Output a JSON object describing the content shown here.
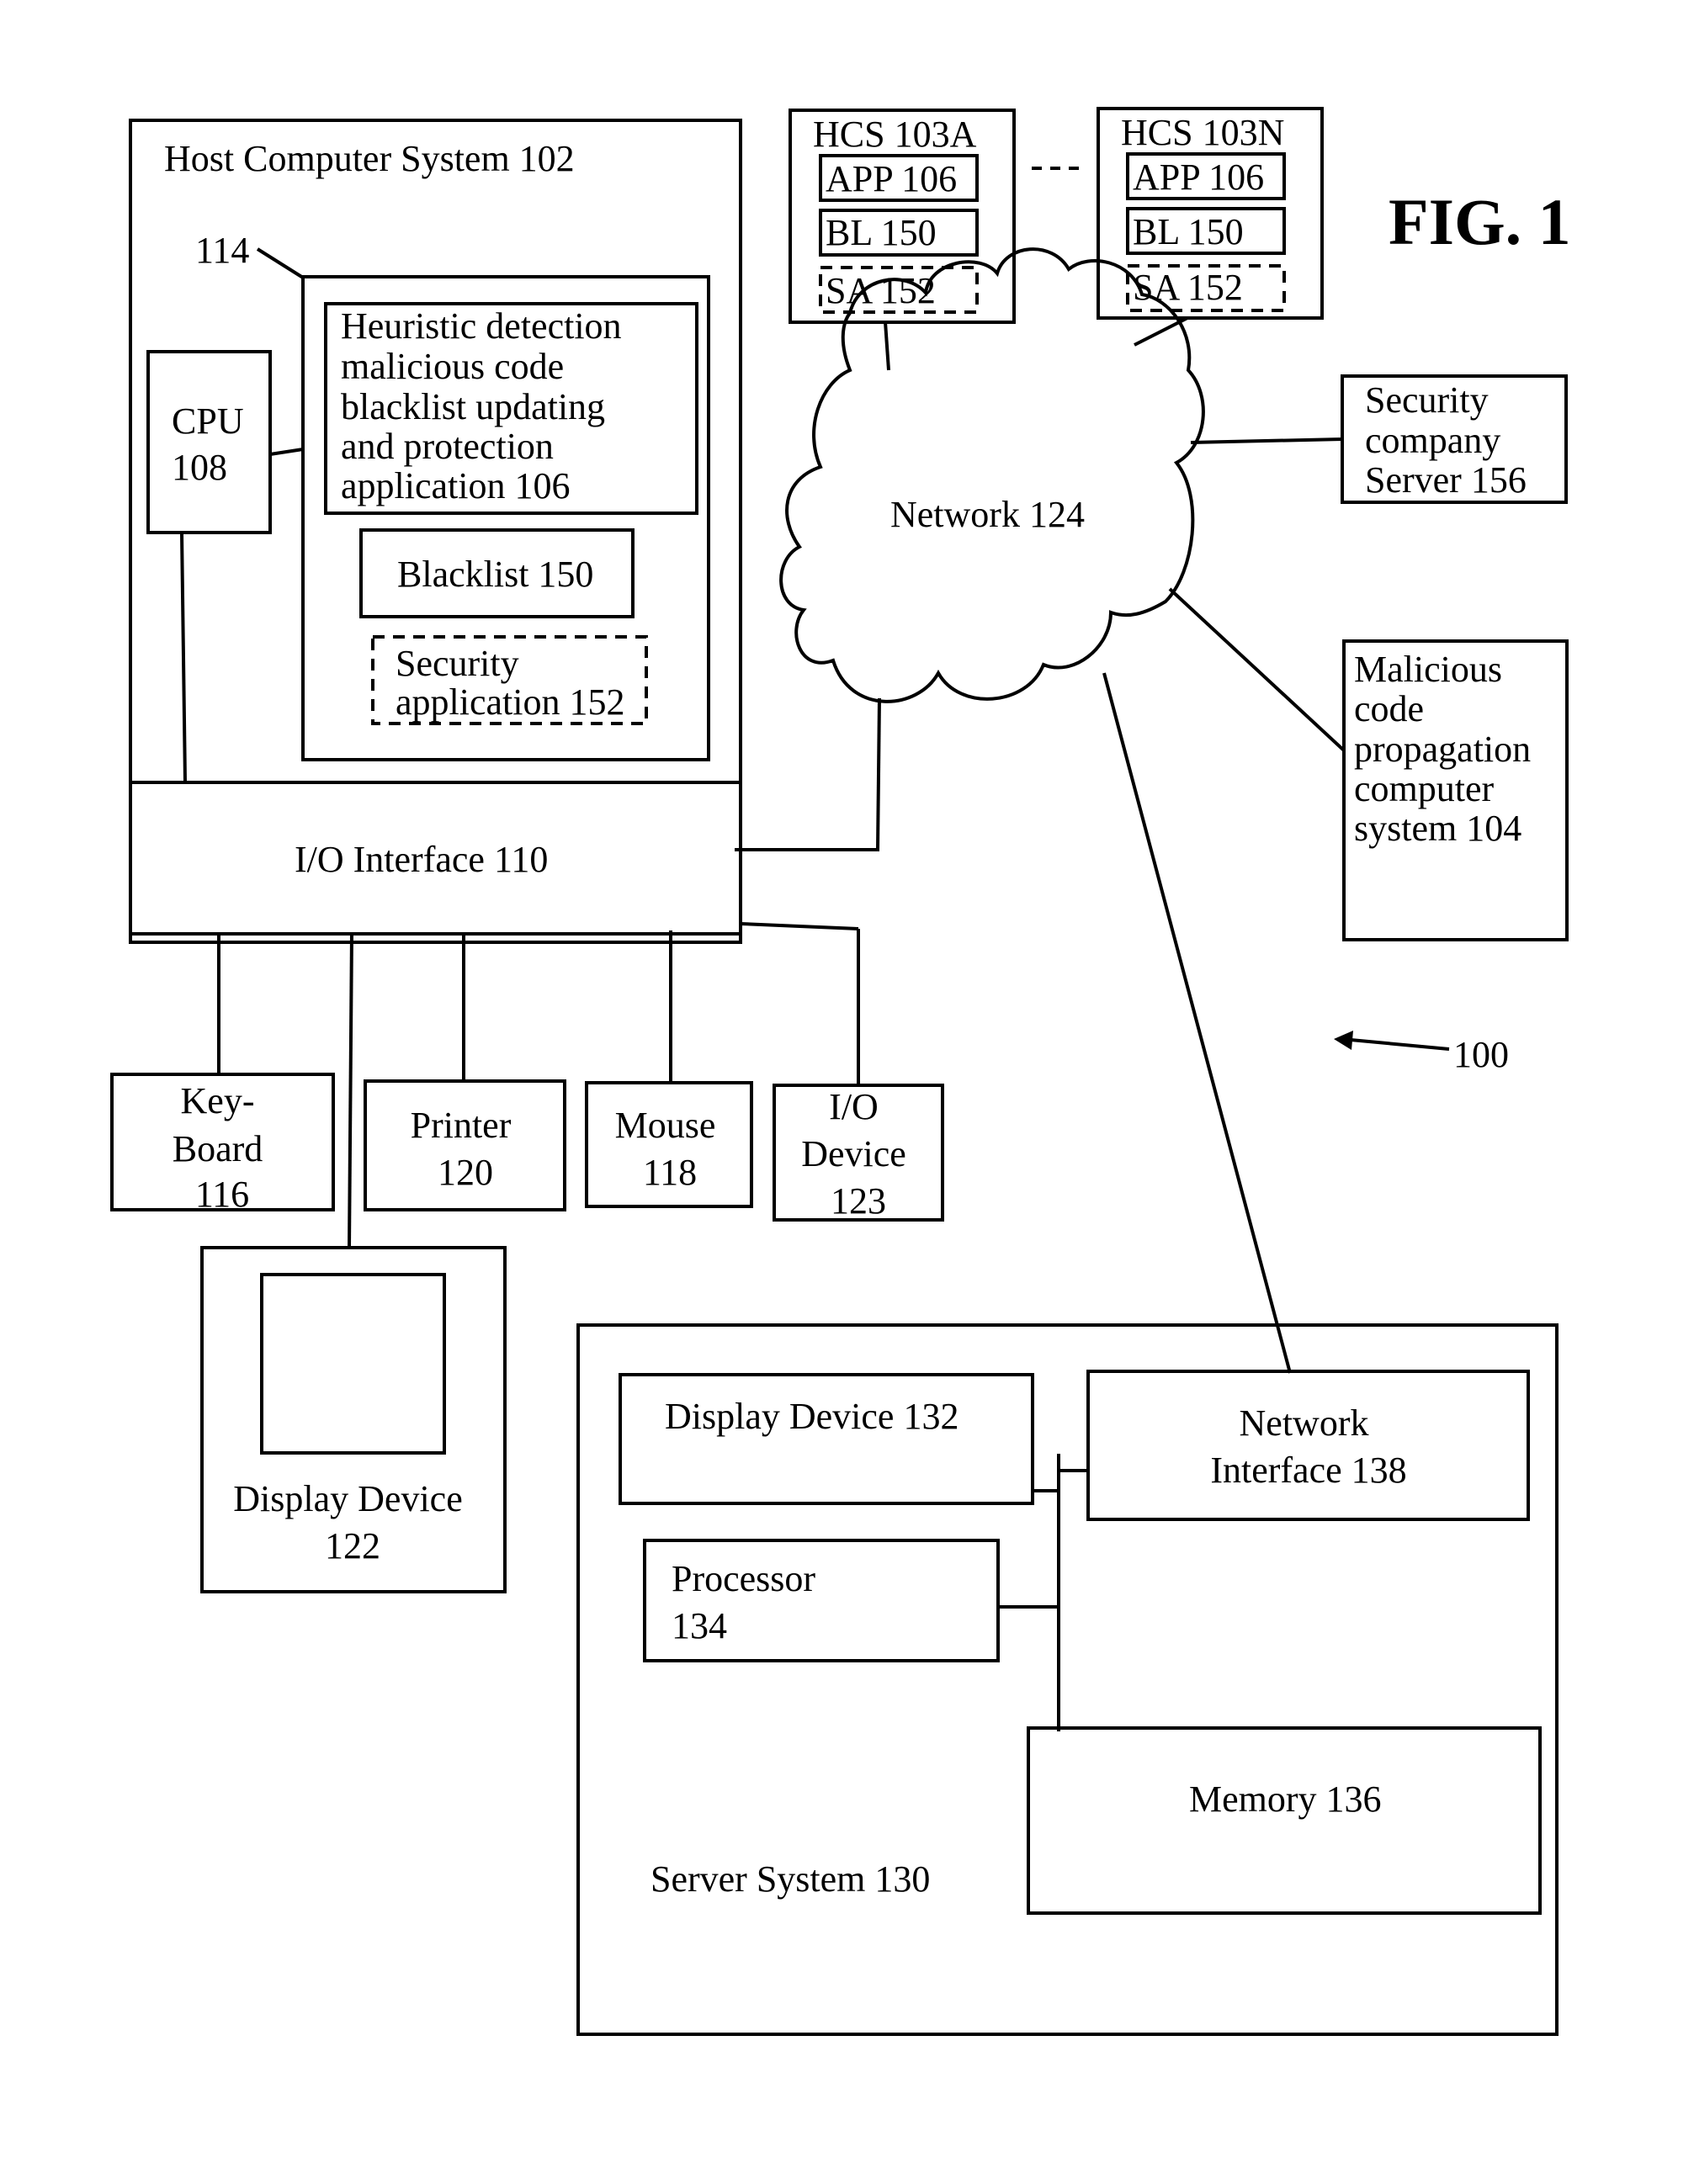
{
  "figure": {
    "title": "FIG. 1",
    "system_ref": "100"
  },
  "host": {
    "title": "Host Computer System 102",
    "memory_ref": "114",
    "app_lines": [
      "Heuristic detection",
      "malicious code",
      "blacklist updating",
      "and protection",
      "application 106"
    ],
    "blacklist": "Blacklist 150",
    "security_app_lines": [
      "Security",
      "application 152"
    ],
    "cpu_lines": [
      "CPU",
      "108"
    ],
    "io_interface": "I/O Interface 110"
  },
  "peripherals": {
    "keyboard_lines": [
      "Key-",
      "Board",
      "116"
    ],
    "printer_lines": [
      "Printer",
      "120"
    ],
    "mouse_lines": [
      "Mouse",
      "118"
    ],
    "io_device_lines": [
      "I/O",
      "Device",
      "123"
    ],
    "display_lines": [
      "Display Device",
      "122"
    ]
  },
  "hcs": [
    {
      "title": "HCS 103A",
      "app": "APP 106",
      "bl": "BL 150",
      "sa": "SA 152"
    },
    {
      "title": "HCS 103N",
      "app": "APP 106",
      "bl": "BL 150",
      "sa": "SA 152"
    }
  ],
  "network": {
    "label": "Network 124"
  },
  "security_server_lines": [
    "Security",
    "company",
    "Server 156"
  ],
  "malicious_lines": [
    "Malicious",
    "code",
    "propagation",
    "computer",
    "system 104"
  ],
  "server": {
    "title": "Server System 130",
    "display": "Display Device 132",
    "network_interface_lines": [
      "Network",
      "Interface 138"
    ],
    "processor_lines": [
      "Processor",
      "134"
    ],
    "memory": "Memory 136"
  }
}
